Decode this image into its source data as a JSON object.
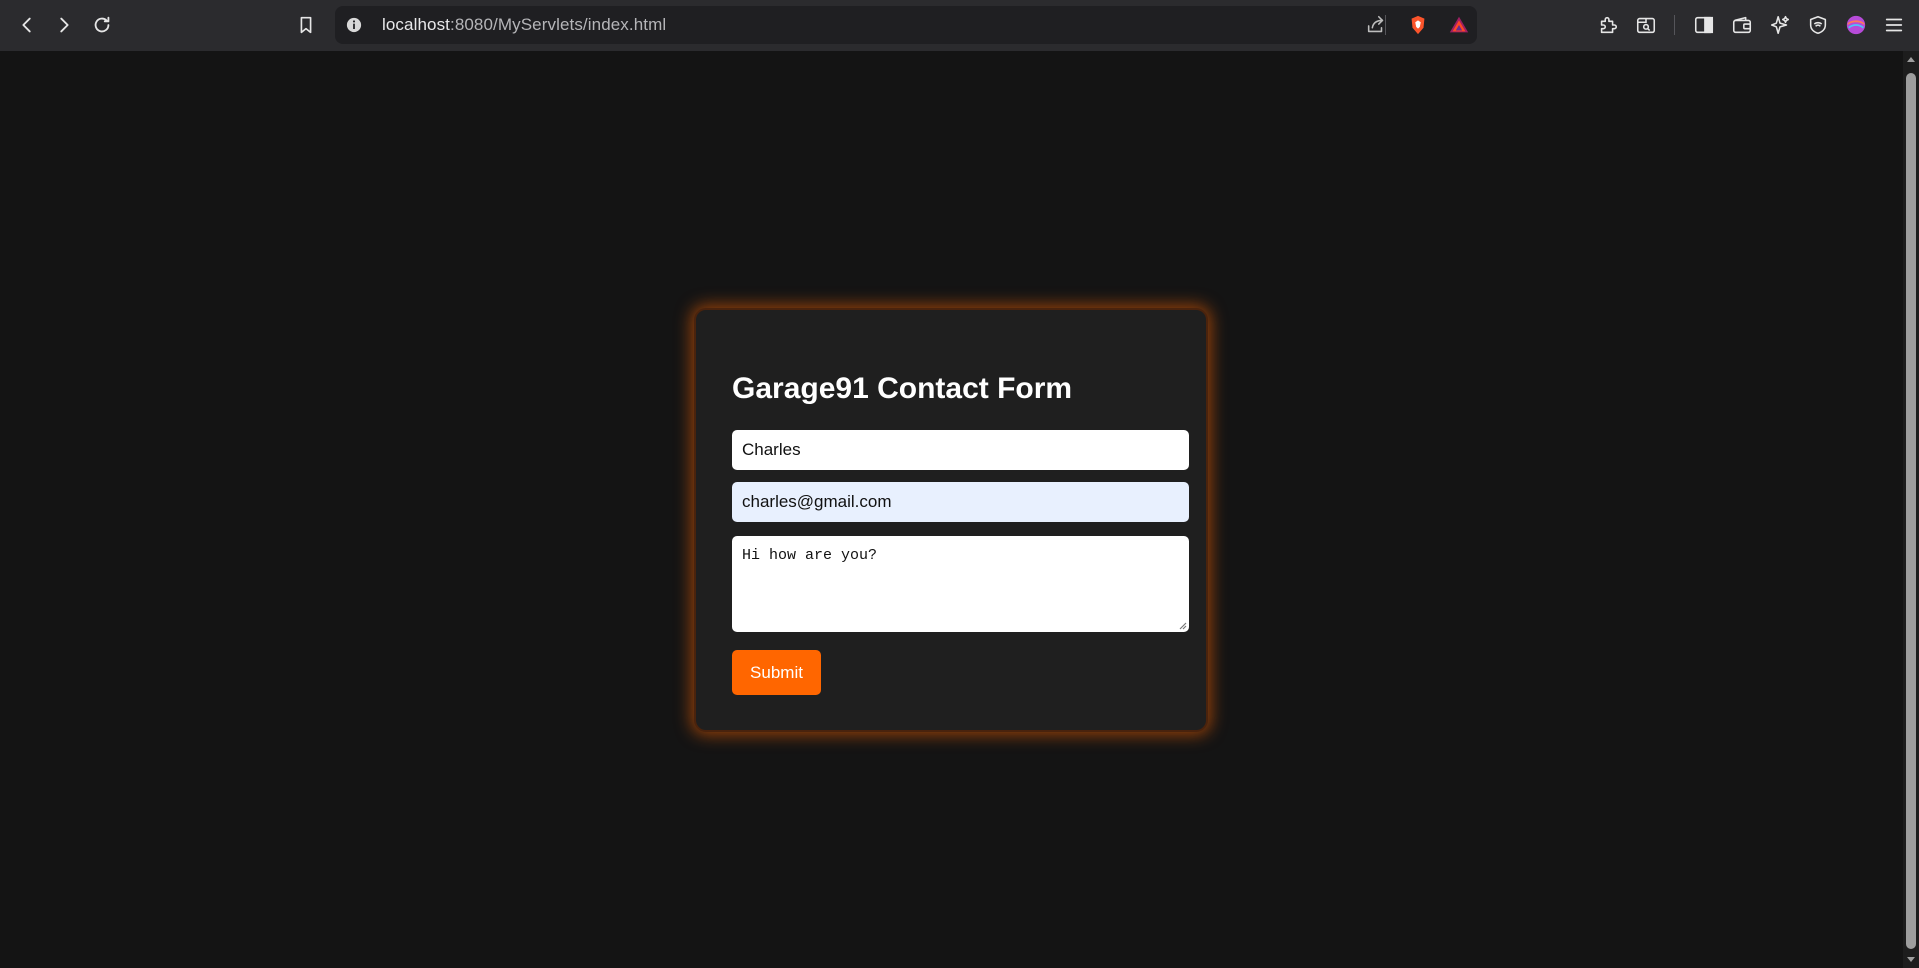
{
  "browser": {
    "url_host": "localhost",
    "url_rest": ":8080/MyServlets/index.html",
    "nav": [
      "back-icon",
      "forward-icon",
      "reload-icon"
    ],
    "toolbar_icons": [
      "bookmark-icon",
      "site-info-icon",
      "share-icon",
      "brave-shields-icon",
      "brave-rewards-icon",
      "extensions-icon",
      "tab-search-icon",
      "sidebar-icon",
      "wallet-icon",
      "leo-ai-icon",
      "vpn-icon",
      "profile-avatar-icon",
      "menu-icon"
    ]
  },
  "form": {
    "title": "Garage91 Contact Form",
    "name_value": "Charles",
    "email_value": "charles@gmail.com",
    "message_value": "Hi how are you?",
    "submit_label": "Submit"
  },
  "colors": {
    "accent": "#ff6600",
    "card_bg": "#1f1f1f",
    "page_bg": "#141414",
    "autofill_bg": "#e8f0fe"
  }
}
